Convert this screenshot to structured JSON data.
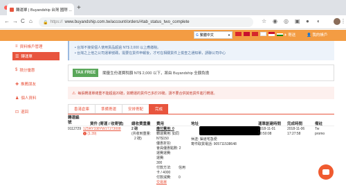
{
  "browser": {
    "tab_title": "轉運單 | Buyandship 台灣 國際 ...",
    "tab_close": "×",
    "new_tab": "+",
    "url_prefix": "https://",
    "url": "www.buyandship.com.tw/account/orders/#tab_status_two_complete",
    "nav": {
      "back": "←",
      "forward": "→",
      "reload": "C",
      "home": "⌂"
    }
  },
  "header": {
    "language_label": "繁體中文",
    "language_arrow": "▼",
    "google_mark": "G",
    "links": {
      "exchange": "✈ 寄送",
      "my_account": "👤 我的帳戶"
    },
    "flag_colors": [
      "#d9262c",
      "#c8102e",
      "#d5262b",
      "#c8102e",
      "#ff9933"
    ]
  },
  "sidebar": {
    "items": [
      {
        "label": "資料帳戶管理",
        "icon": "user-icon",
        "glyph": "≡"
      },
      {
        "label": "轉運單",
        "icon": "box-icon",
        "glyph": "☰",
        "active": true
      },
      {
        "label": "積分優惠",
        "icon": "dollar-icon",
        "glyph": "$"
      },
      {
        "label": "推薦朋友",
        "icon": "gift-icon",
        "glyph": "✚"
      },
      {
        "label": "個人資料",
        "icon": "person-icon",
        "glyph": "♟"
      },
      {
        "label": "退回",
        "icon": "return-icon",
        "glyph": "⊡"
      }
    ]
  },
  "notice": {
    "line1": "• 台灣不接受個人使用貨品超過 NT$ 2,000 以上應繳稅。",
    "line2": "• 台灣之上他之公司運單號碼，需要在貨件申報後，才可在相關貨件上檢查之通知單，請聯公司中心"
  },
  "tax": {
    "badge": "TAX FREE",
    "text": "閣量生份運費稅額 NT$ 2,000 以下，將由 Buyandship 全額負擔"
  },
  "warning": {
    "icon": "!",
    "text": "每張轉運單總重不能超過20磅，如轉運的貨件已多於20磅，請不要合併其他貨件進行轉運。"
  },
  "tabs": [
    {
      "label": "香港倉庫"
    },
    {
      "label": "準備寄運"
    },
    {
      "label": "安排寄配"
    },
    {
      "label": "完成",
      "active": true
    }
  ],
  "table": {
    "first_header": [
      "轉運編",
      "號"
    ],
    "headers": {
      "tracking": "貨件 (寄運 / 收寄號)",
      "weight": "總收費重量",
      "fee": "費用",
      "address": "地址",
      "created": "運單創建時間",
      "completed": "完成時間",
      "note": "備註"
    },
    "row": {
      "id": "9112729",
      "tracking_no": "1Z5RY338YW1T1T3008",
      "tracking_sub": "(1.39)",
      "tracking_warn_icon": "!",
      "weight": "2 磅",
      "weight_detail": [
        "(共收到重量:",
        "2 磅)"
      ],
      "fee_total": "應付費用: 0",
      "fee_lines": [
        "轉運費用: 如同",
        "NT$150",
        "優惠折扣:",
        "會員優惠點數: 2",
        "運費運費:",
        "運費:",
        "300",
        "付款方法:",
        "信用",
        "卡 / 4000",
        "付款減費:",
        "0"
      ],
      "fee_link": "交易單",
      "address_lines": [
        "休送: 渠道宅急便",
        "寄件取貨電話: 905711538648"
      ],
      "created_date": "2018-11-01",
      "created_time": "10:50:08",
      "completed_date": "2018-11-06",
      "completed_time": "17:27:58",
      "note_lines": [
        "Tw",
        "promo"
      ]
    }
  }
}
